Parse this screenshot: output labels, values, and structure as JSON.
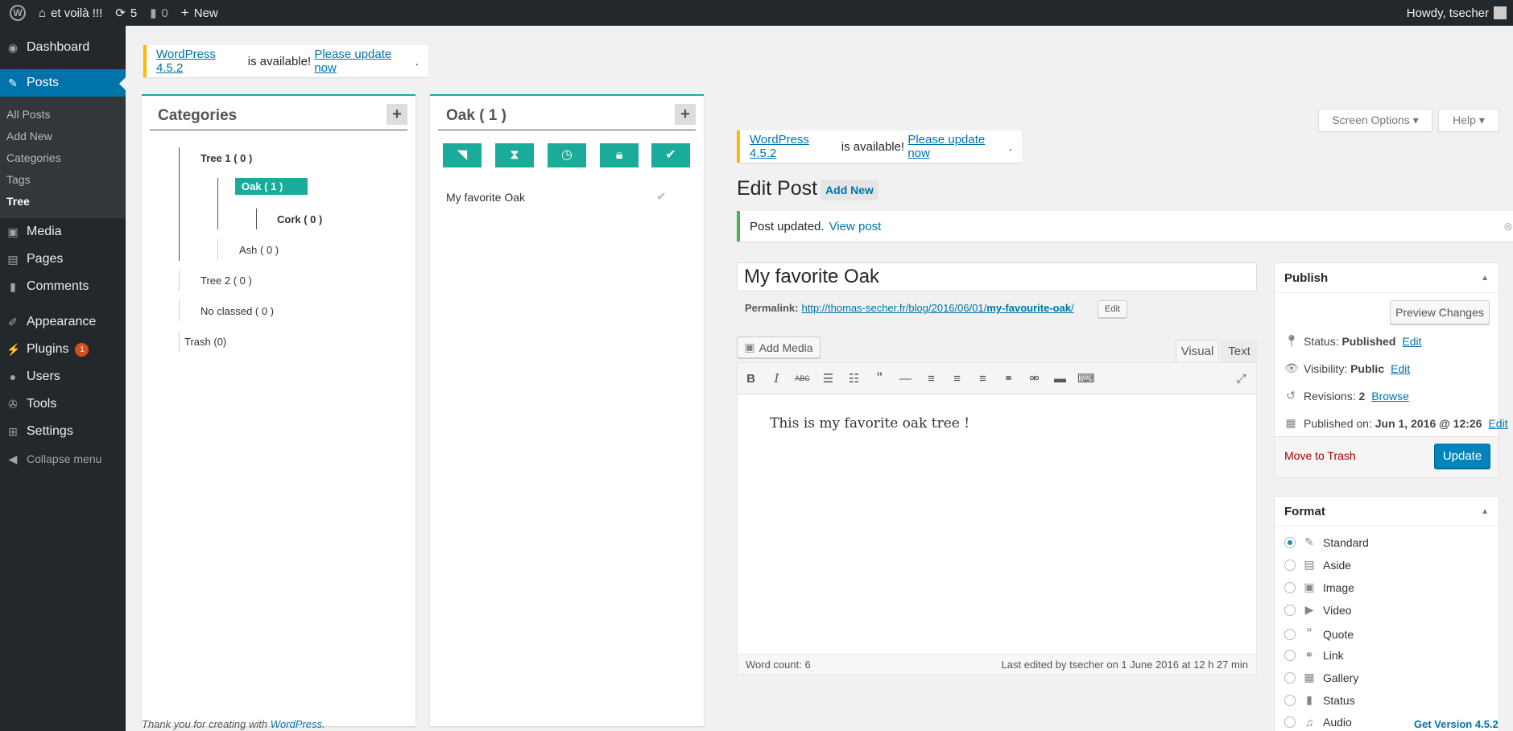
{
  "adminbar": {
    "site_name": "et voilà !!!",
    "updates_count": "5",
    "comments_count": "0",
    "new_label": "New",
    "howdy": "Howdy, tsecher"
  },
  "sidebar": {
    "dashboard": "Dashboard",
    "posts": "Posts",
    "posts_sub": [
      "All Posts",
      "Add New",
      "Categories",
      "Tags",
      "Tree"
    ],
    "media": "Media",
    "pages": "Pages",
    "comments": "Comments",
    "appearance": "Appearance",
    "plugins": "Plugins",
    "plugins_badge": "1",
    "users": "Users",
    "tools": "Tools",
    "settings": "Settings",
    "collapse": "Collapse menu"
  },
  "notice_top": {
    "link1": "WordPress 4.5.2",
    "text": " is available! ",
    "link2": "Please update now",
    "end": "."
  },
  "categories_panel": {
    "title": "Categories",
    "add": "+",
    "nodes": {
      "tree1": "Tree 1 ( 0 )",
      "oak": "Oak ( 1 )",
      "cork": "Cork ( 0 )",
      "ash": "Ash ( 0 )",
      "tree2": "Tree 2 ( 0 )",
      "noclassed": "No classed ( 0 )",
      "trash": "Trash (0)"
    }
  },
  "oak_panel": {
    "title": "Oak ( 1 )",
    "add": "+",
    "post_item": "My favorite Oak"
  },
  "screen_options": {
    "screen": "Screen Options ▾",
    "help": "Help ▾"
  },
  "notice_editor": {
    "link1": "WordPress 4.5.2",
    "text": " is available! ",
    "link2": "Please update now",
    "end": "."
  },
  "edit": {
    "heading": "Edit Post",
    "add_new": "Add New",
    "updated_text": "Post updated.",
    "view_post": "View post",
    "title_value": "My favorite Oak",
    "permalink_label": "Permalink:",
    "permalink_url": "http://thomas-secher.fr/blog/2016/06/01/",
    "permalink_slug": "my-favourite-oak",
    "permalink_end": "/",
    "permalink_edit": "Edit",
    "add_media": "Add Media",
    "tab_visual": "Visual",
    "tab_text": "Text",
    "content": "This is my favorite oak tree !",
    "word_count": "Word count: 6",
    "last_edited": "Last edited by tsecher on 1 June 2016 at 12 h 27 min"
  },
  "publish": {
    "title": "Publish",
    "preview": "Preview Changes",
    "status_label": "Status: ",
    "status_value": "Published",
    "visibility_label": "Visibility: ",
    "visibility_value": "Public",
    "revisions_label": "Revisions: ",
    "revisions_value": "2",
    "browse": "Browse",
    "published_label": "Published on: ",
    "published_value": "Jun 1, 2016 @ 12:26",
    "edit": "Edit",
    "trash": "Move to Trash",
    "update": "Update"
  },
  "format": {
    "title": "Format",
    "options": [
      "Standard",
      "Aside",
      "Image",
      "Video",
      "Quote",
      "Link",
      "Gallery",
      "Status",
      "Audio"
    ],
    "selected": "Standard"
  },
  "footer": {
    "thanks": "Thank you for creating with ",
    "wp": "WordPress",
    "dot": ".",
    "version": "Get Version 4.5.2"
  }
}
